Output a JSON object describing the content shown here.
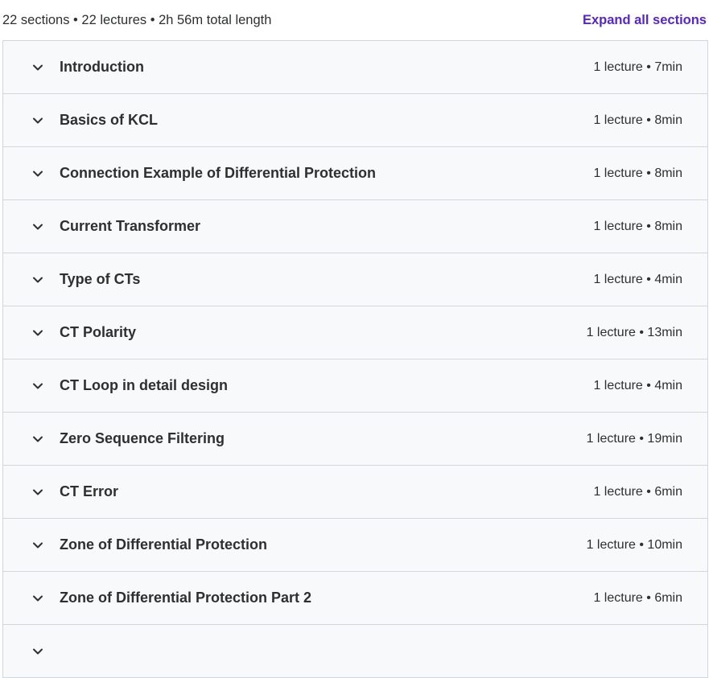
{
  "summary": {
    "text": "22 sections • 22 lectures • 2h 56m total length",
    "expand_label": "Expand all sections"
  },
  "colors": {
    "accent": "#5624d0",
    "row_bg": "#f7f9fa",
    "border": "#d1d7dc",
    "text": "#2d2f31"
  },
  "sections": [
    {
      "title": "Introduction",
      "meta": "1 lecture • 7min",
      "icon": "chevron-down-icon"
    },
    {
      "title": "Basics of KCL",
      "meta": "1 lecture • 8min",
      "icon": "chevron-down-icon"
    },
    {
      "title": "Connection Example of Differential Protection",
      "meta": "1 lecture • 8min",
      "icon": "chevron-down-icon"
    },
    {
      "title": "Current Transformer",
      "meta": "1 lecture • 8min",
      "icon": "chevron-down-icon"
    },
    {
      "title": "Type of CTs",
      "meta": "1 lecture • 4min",
      "icon": "chevron-down-icon"
    },
    {
      "title": "CT Polarity",
      "meta": "1 lecture • 13min",
      "icon": "chevron-down-icon"
    },
    {
      "title": "CT Loop in detail design",
      "meta": "1 lecture • 4min",
      "icon": "chevron-down-icon"
    },
    {
      "title": "Zero Sequence Filtering",
      "meta": "1 lecture • 19min",
      "icon": "chevron-down-icon"
    },
    {
      "title": "CT Error",
      "meta": "1 lecture • 6min",
      "icon": "chevron-down-icon"
    },
    {
      "title": "Zone of Differential Protection",
      "meta": "1 lecture • 10min",
      "icon": "chevron-down-icon"
    },
    {
      "title": "Zone of Differential Protection Part 2",
      "meta": "1 lecture • 6min",
      "icon": "chevron-down-icon"
    },
    {
      "title": "",
      "meta": "",
      "icon": "chevron-down-icon"
    }
  ]
}
